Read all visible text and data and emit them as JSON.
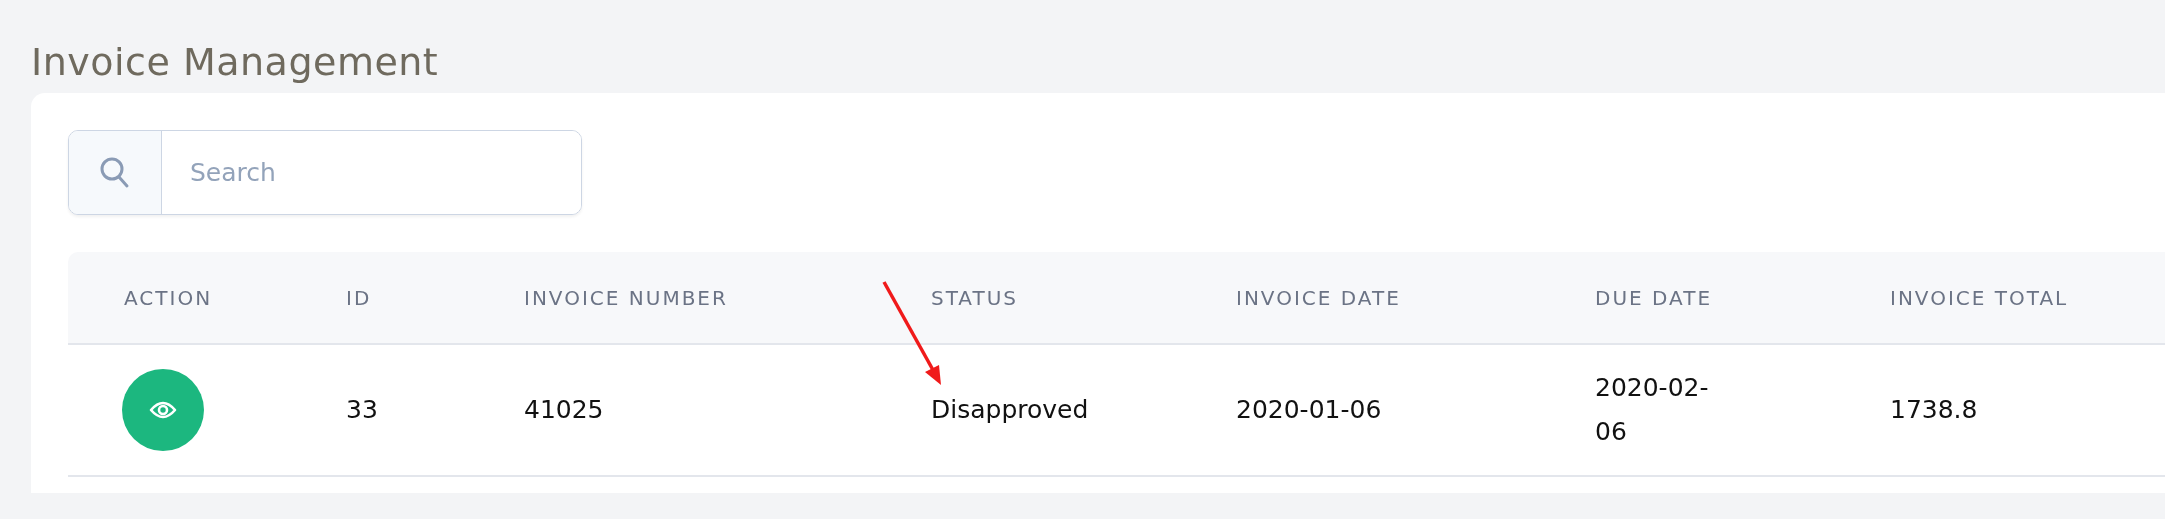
{
  "page": {
    "title": "Invoice Management"
  },
  "search": {
    "placeholder": "Search"
  },
  "table": {
    "columns": [
      "ACTION",
      "ID",
      "INVOICE NUMBER",
      "STATUS",
      "INVOICE DATE",
      "DUE DATE",
      "INVOICE TOTAL"
    ],
    "rows": [
      {
        "id": "33",
        "invoice_number": "41025",
        "status": "Disapproved",
        "invoice_date": "2020-01-06",
        "due_date": "2020-02-06",
        "invoice_total": "1738.8"
      }
    ]
  }
}
